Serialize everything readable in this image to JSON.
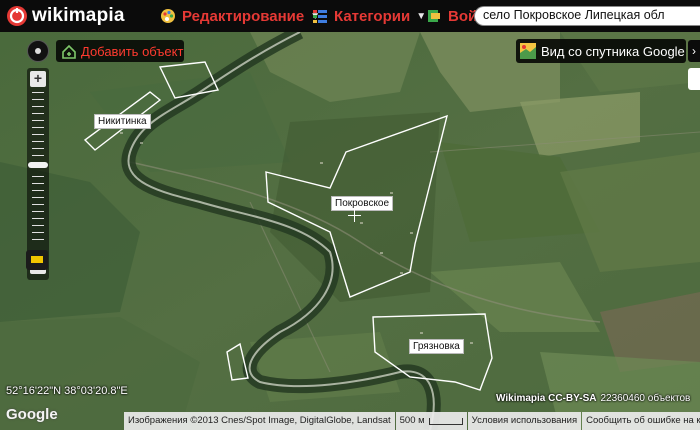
{
  "topbar": {
    "logo_text": "wikimapia",
    "menu": [
      {
        "label": "Редактирование",
        "icon": "palette-icon"
      },
      {
        "label": "Категории",
        "icon": "categories-icon"
      },
      {
        "label": "Войт",
        "icon": "login-icon"
      }
    ],
    "search_value": "село Покровское Липецкая обл"
  },
  "toolbar": {
    "add_object_label": "Добавить объект",
    "satellite_label": "Вид со спутника Google"
  },
  "map": {
    "place_labels": [
      "Никитинка",
      "Покровское",
      "Грязновка"
    ],
    "coordinates": "52°16'22\"N 38°03'20.8\"E",
    "google_logo": "Google",
    "license_label": "Wikimapia CC-BY-SA",
    "object_count": "22360460 объектов",
    "attribution": "Изображения ©2013 Cnes/Spot Image, DigitalGlobe, Landsat",
    "scale_label": "500 м",
    "terms_label": "Условия использования",
    "report_label": "Сообщить об ошибке на карт"
  },
  "colors": {
    "accent": "#e53935",
    "topbar_bg": "#0b0b0b"
  }
}
